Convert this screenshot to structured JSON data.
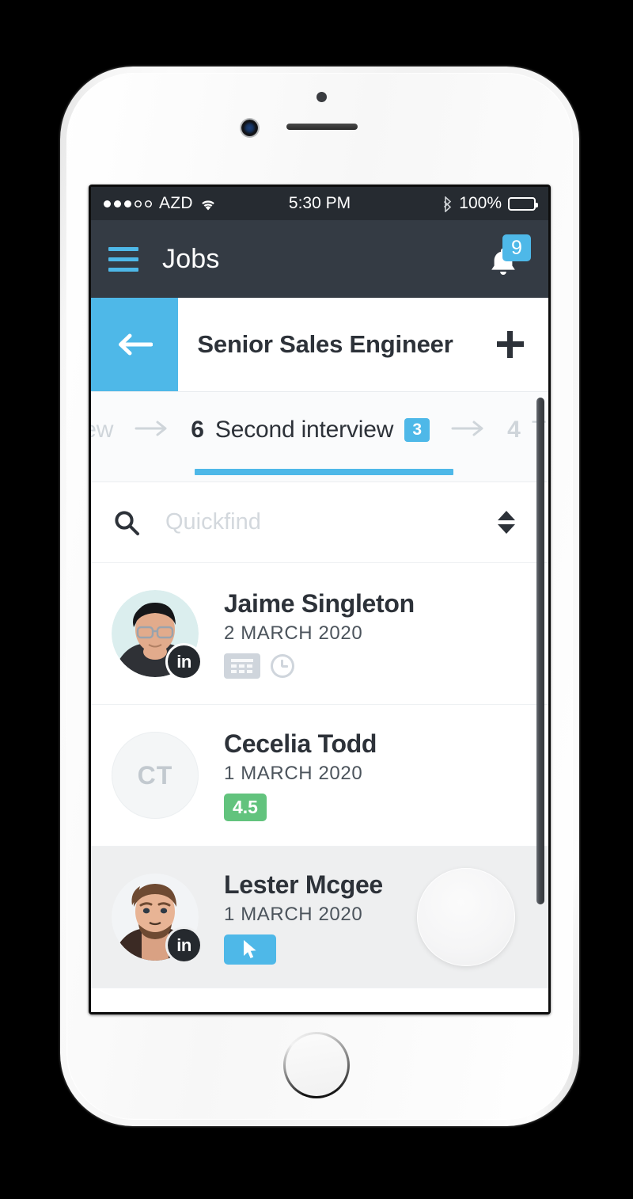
{
  "device": {
    "name": "iphone-white",
    "status_bar": {
      "signal_dots_filled": 3,
      "signal_dots_total": 5,
      "carrier": "AZD",
      "time": "5:30 PM",
      "battery_percent": "100%",
      "bluetooth": "bluetooth-icon",
      "wifi": "wifi-icon"
    }
  },
  "app_header": {
    "menu_icon": "hamburger-menu-icon",
    "title": "Jobs",
    "bell_icon": "bell-icon",
    "notification_count": "9",
    "accent": "#4eb8e8",
    "background": "#343b44"
  },
  "sub_header": {
    "back_icon": "arrow-left-icon",
    "title": "Senior Sales Engineer",
    "add_icon": "plus-icon",
    "back_bg": "#4eb8e8"
  },
  "stages": [
    {
      "count": "",
      "label": "view",
      "badge": "",
      "active": false,
      "truncated_left": true
    },
    {
      "count": "6",
      "label": "Second interview",
      "badge": "3",
      "active": true
    },
    {
      "count": "4",
      "label": "T",
      "badge": "",
      "active": false,
      "truncated_right": true
    }
  ],
  "stage_arrow": "→",
  "search": {
    "icon": "search-icon",
    "placeholder": "Quickfind",
    "value": "",
    "sort_icon": "sort-updown-icon"
  },
  "candidates": [
    {
      "name": "Jaime Singleton",
      "date": "2 MARCH 2020",
      "avatar_type": "photo",
      "avatar_kind": "man-glasses",
      "linkedin_badge": "in",
      "badges": [
        {
          "type": "tablet-icon"
        },
        {
          "type": "clock-icon"
        }
      ],
      "selected": false
    },
    {
      "name": "Cecelia Todd",
      "date": "1 MARCH 2020",
      "avatar_type": "initials",
      "initials": "CT",
      "linkedin_badge": "",
      "badges": [
        {
          "type": "score",
          "value": "4.5",
          "color": "#62c37d"
        }
      ],
      "selected": false
    },
    {
      "name": "Lester Mcgee",
      "date": "1 MARCH 2020",
      "avatar_type": "photo",
      "avatar_kind": "man-beard",
      "linkedin_badge": "in",
      "badges": [
        {
          "type": "cursor-icon",
          "color": "#4eb8e8"
        }
      ],
      "selected": true,
      "tap_indicator": true
    }
  ],
  "scrollbar": {
    "name": "vertical-scrollbar",
    "visible": true
  }
}
